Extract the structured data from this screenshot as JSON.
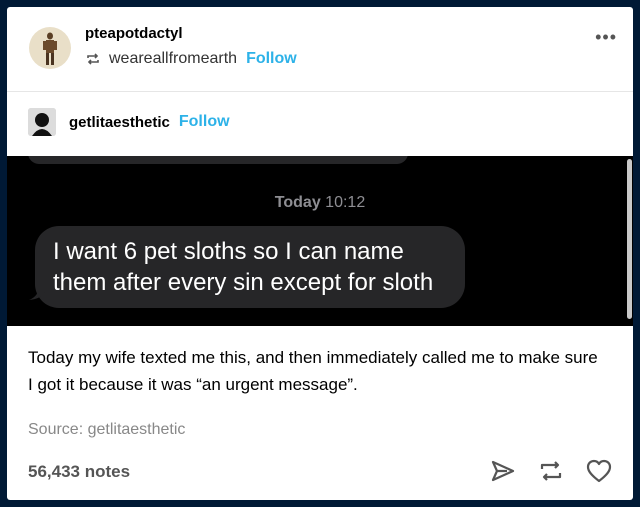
{
  "post": {
    "author": "pteapotdactyl",
    "reblogged_from": "weareallfromearth",
    "follow_label": "Follow",
    "more_label": "•••"
  },
  "source_blog": {
    "name": "getlitaesthetic",
    "follow_label": "Follow"
  },
  "message_image": {
    "timestamp_day": "Today",
    "timestamp_time": "10:12",
    "message_text": "I want 6 pet sloths so I can name them after every sin except for sloth"
  },
  "caption": "Today my wife texted me this, and then immediately called me to make sure I got it because it was “an urgent message”.",
  "source_line": "Source: getlitaesthetic",
  "notes": "56,433 notes",
  "colors": {
    "page_background": "#001935",
    "accent_follow": "#2db2e8",
    "imessage_bubble": "#262628"
  },
  "icons": [
    "reblog-icon",
    "more-icon",
    "share-icon",
    "reblog-action-icon",
    "like-icon"
  ]
}
